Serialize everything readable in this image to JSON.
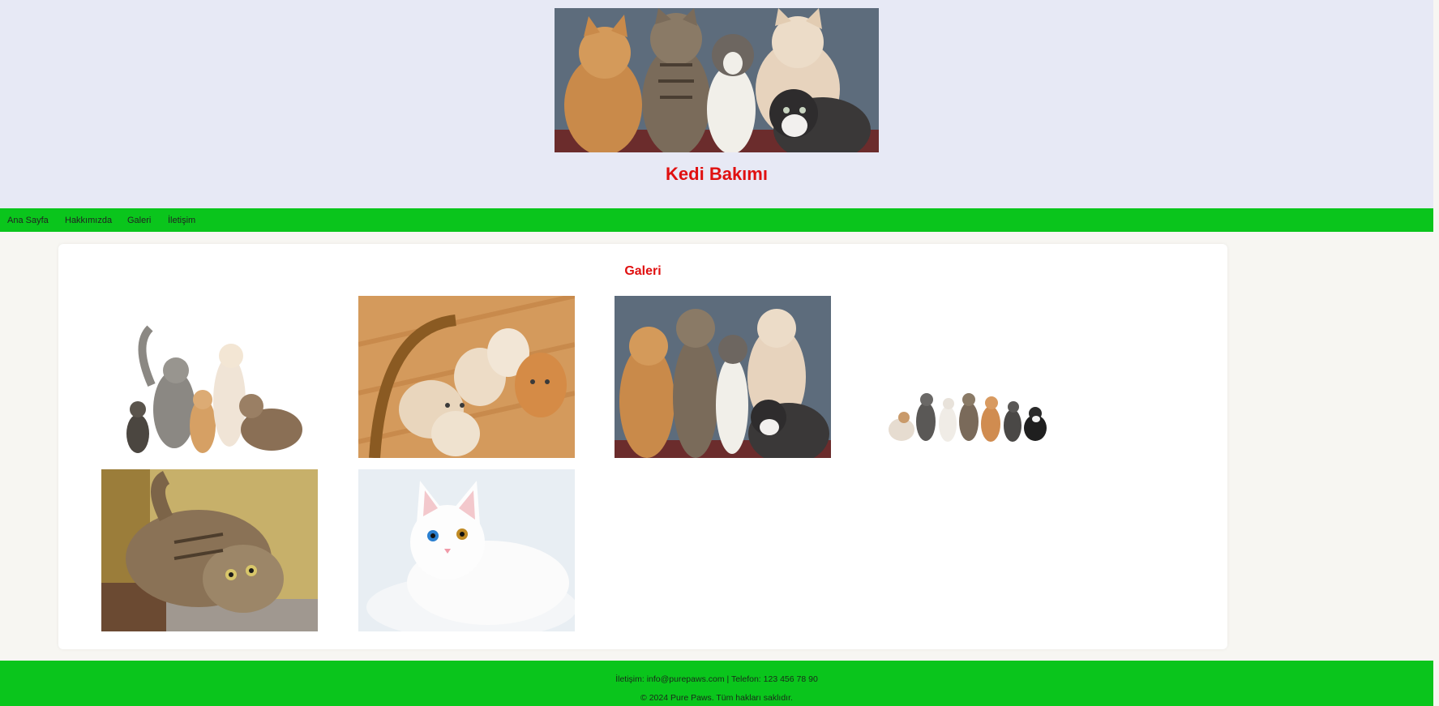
{
  "header": {
    "banner_image": "cat-kittens-group-photo",
    "title": "Kedi Bakımı"
  },
  "nav": {
    "items": [
      {
        "label": "Ana Sayfa"
      },
      {
        "label": "Hakkımızda"
      },
      {
        "label": "Galeri"
      },
      {
        "label": "İletişim"
      }
    ]
  },
  "gallery": {
    "heading": "Galeri",
    "photos": [
      {
        "subject": "five-cats-white-background"
      },
      {
        "subject": "kittens-in-basket"
      },
      {
        "subject": "five-kittens-group"
      },
      {
        "subject": "row-of-cats"
      },
      {
        "subject": "tabby-cat-lying"
      },
      {
        "subject": "white-cat-odd-eyes"
      }
    ]
  },
  "footer": {
    "contact": "İletişim: info@purepaws.com | Telefon: 123 456 78 90",
    "copyright": "© 2024 Pure Paws. Tüm hakları saklıdır."
  },
  "colors": {
    "header_bg": "#e7e9f5",
    "accent_red": "#e01010",
    "nav_green": "#0ac51c",
    "page_bg": "#f7f6f2"
  }
}
